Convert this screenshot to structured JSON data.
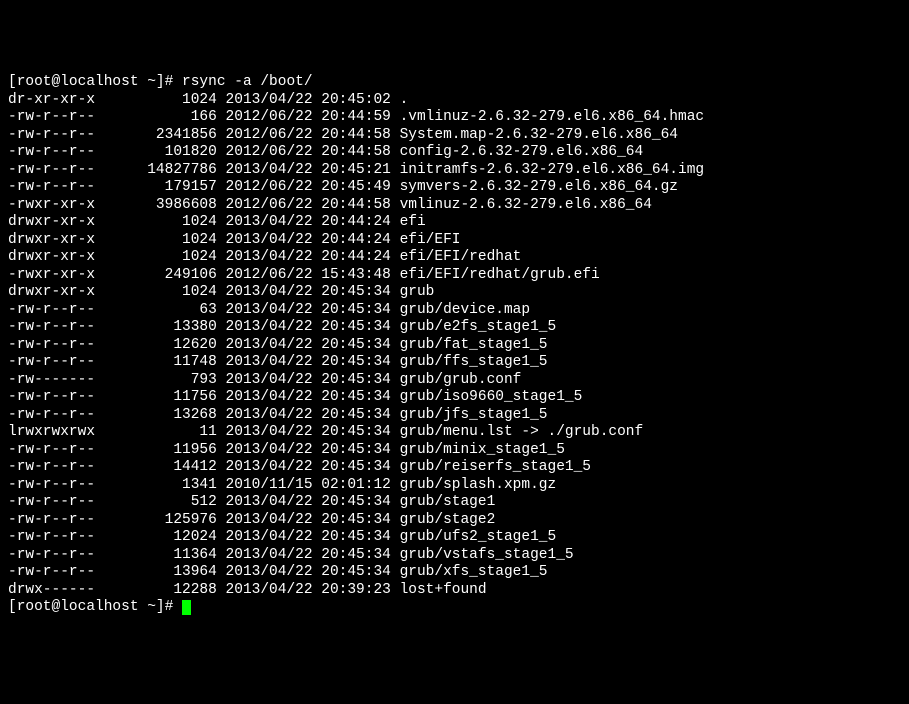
{
  "prompt1": "[root@localhost ~]# ",
  "command": "rsync -a /boot/",
  "rows": [
    {
      "perm": "dr-xr-xr-x",
      "size": "1024",
      "date": "2013/04/22",
      "time": "20:45:02",
      "name": "."
    },
    {
      "perm": "-rw-r--r--",
      "size": "166",
      "date": "2012/06/22",
      "time": "20:44:59",
      "name": ".vmlinuz-2.6.32-279.el6.x86_64.hmac"
    },
    {
      "perm": "-rw-r--r--",
      "size": "2341856",
      "date": "2012/06/22",
      "time": "20:44:58",
      "name": "System.map-2.6.32-279.el6.x86_64"
    },
    {
      "perm": "-rw-r--r--",
      "size": "101820",
      "date": "2012/06/22",
      "time": "20:44:58",
      "name": "config-2.6.32-279.el6.x86_64"
    },
    {
      "perm": "-rw-r--r--",
      "size": "14827786",
      "date": "2013/04/22",
      "time": "20:45:21",
      "name": "initramfs-2.6.32-279.el6.x86_64.img"
    },
    {
      "perm": "-rw-r--r--",
      "size": "179157",
      "date": "2012/06/22",
      "time": "20:45:49",
      "name": "symvers-2.6.32-279.el6.x86_64.gz"
    },
    {
      "perm": "-rwxr-xr-x",
      "size": "3986608",
      "date": "2012/06/22",
      "time": "20:44:58",
      "name": "vmlinuz-2.6.32-279.el6.x86_64"
    },
    {
      "perm": "drwxr-xr-x",
      "size": "1024",
      "date": "2013/04/22",
      "time": "20:44:24",
      "name": "efi"
    },
    {
      "perm": "drwxr-xr-x",
      "size": "1024",
      "date": "2013/04/22",
      "time": "20:44:24",
      "name": "efi/EFI"
    },
    {
      "perm": "drwxr-xr-x",
      "size": "1024",
      "date": "2013/04/22",
      "time": "20:44:24",
      "name": "efi/EFI/redhat"
    },
    {
      "perm": "-rwxr-xr-x",
      "size": "249106",
      "date": "2012/06/22",
      "time": "15:43:48",
      "name": "efi/EFI/redhat/grub.efi"
    },
    {
      "perm": "drwxr-xr-x",
      "size": "1024",
      "date": "2013/04/22",
      "time": "20:45:34",
      "name": "grub"
    },
    {
      "perm": "-rw-r--r--",
      "size": "63",
      "date": "2013/04/22",
      "time": "20:45:34",
      "name": "grub/device.map"
    },
    {
      "perm": "-rw-r--r--",
      "size": "13380",
      "date": "2013/04/22",
      "time": "20:45:34",
      "name": "grub/e2fs_stage1_5"
    },
    {
      "perm": "-rw-r--r--",
      "size": "12620",
      "date": "2013/04/22",
      "time": "20:45:34",
      "name": "grub/fat_stage1_5"
    },
    {
      "perm": "-rw-r--r--",
      "size": "11748",
      "date": "2013/04/22",
      "time": "20:45:34",
      "name": "grub/ffs_stage1_5"
    },
    {
      "perm": "-rw-------",
      "size": "793",
      "date": "2013/04/22",
      "time": "20:45:34",
      "name": "grub/grub.conf"
    },
    {
      "perm": "-rw-r--r--",
      "size": "11756",
      "date": "2013/04/22",
      "time": "20:45:34",
      "name": "grub/iso9660_stage1_5"
    },
    {
      "perm": "-rw-r--r--",
      "size": "13268",
      "date": "2013/04/22",
      "time": "20:45:34",
      "name": "grub/jfs_stage1_5"
    },
    {
      "perm": "lrwxrwxrwx",
      "size": "11",
      "date": "2013/04/22",
      "time": "20:45:34",
      "name": "grub/menu.lst -> ./grub.conf"
    },
    {
      "perm": "-rw-r--r--",
      "size": "11956",
      "date": "2013/04/22",
      "time": "20:45:34",
      "name": "grub/minix_stage1_5"
    },
    {
      "perm": "-rw-r--r--",
      "size": "14412",
      "date": "2013/04/22",
      "time": "20:45:34",
      "name": "grub/reiserfs_stage1_5"
    },
    {
      "perm": "-rw-r--r--",
      "size": "1341",
      "date": "2010/11/15",
      "time": "02:01:12",
      "name": "grub/splash.xpm.gz"
    },
    {
      "perm": "-rw-r--r--",
      "size": "512",
      "date": "2013/04/22",
      "time": "20:45:34",
      "name": "grub/stage1"
    },
    {
      "perm": "-rw-r--r--",
      "size": "125976",
      "date": "2013/04/22",
      "time": "20:45:34",
      "name": "grub/stage2"
    },
    {
      "perm": "-rw-r--r--",
      "size": "12024",
      "date": "2013/04/22",
      "time": "20:45:34",
      "name": "grub/ufs2_stage1_5"
    },
    {
      "perm": "-rw-r--r--",
      "size": "11364",
      "date": "2013/04/22",
      "time": "20:45:34",
      "name": "grub/vstafs_stage1_5"
    },
    {
      "perm": "-rw-r--r--",
      "size": "13964",
      "date": "2013/04/22",
      "time": "20:45:34",
      "name": "grub/xfs_stage1_5"
    },
    {
      "perm": "drwx------",
      "size": "12288",
      "date": "2013/04/22",
      "time": "20:39:23",
      "name": "lost+found"
    }
  ],
  "prompt2": "[root@localhost ~]# "
}
